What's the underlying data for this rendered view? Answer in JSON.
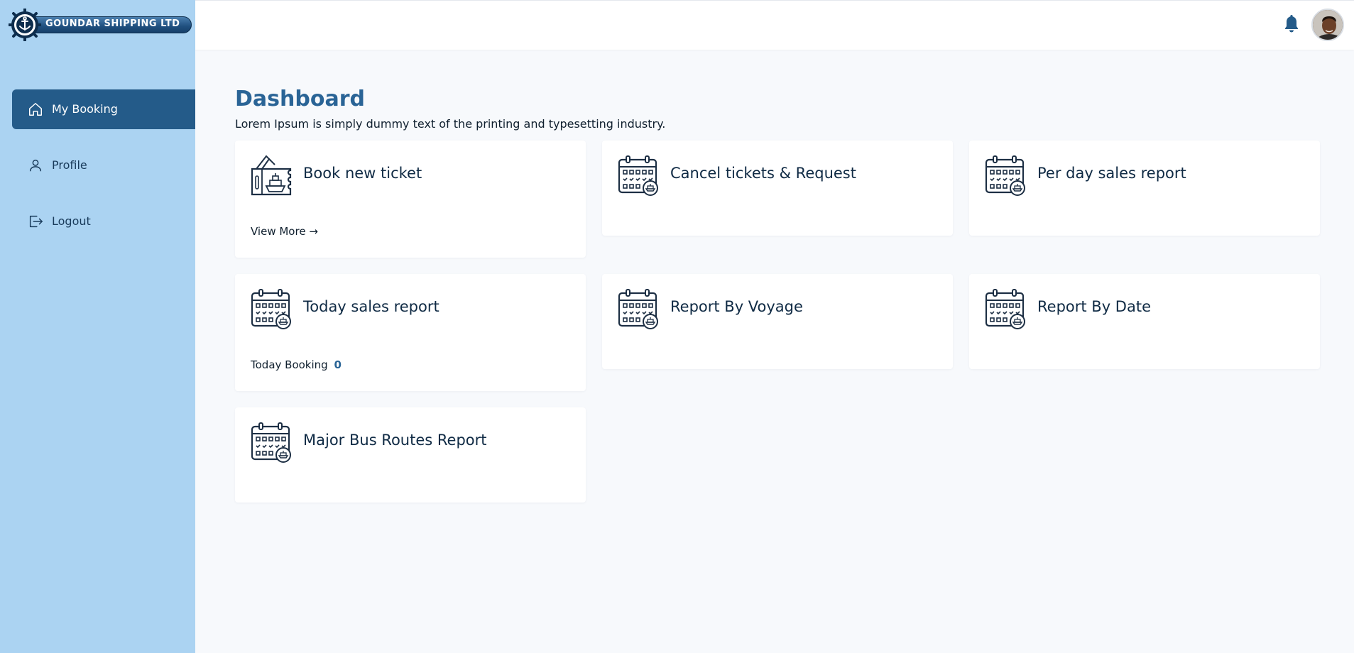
{
  "brand": {
    "name": "GOUNDAR SHIPPING LTD"
  },
  "sidebar": {
    "items": [
      {
        "label": "My Booking",
        "icon": "home-icon",
        "active": true
      },
      {
        "label": "Profile",
        "icon": "user-icon",
        "active": false
      },
      {
        "label": "Logout",
        "icon": "logout-icon",
        "active": false
      }
    ]
  },
  "header": {
    "notification_icon": "bell-icon",
    "avatar": "user-avatar"
  },
  "page": {
    "title": "Dashboard",
    "subtitle": "Lorem Ipsum is simply dummy text of the printing and typesetting industry."
  },
  "cards": [
    {
      "title": "Book new ticket",
      "icon": "ticket-ship-icon",
      "footer_label": "View More",
      "footer_arrow": "→"
    },
    {
      "title": "Cancel tickets & Request",
      "icon": "calendar-ship-icon"
    },
    {
      "title": "Per day sales report",
      "icon": "calendar-ship-icon"
    },
    {
      "title": "Today sales report",
      "icon": "calendar-ship-icon",
      "footer_label": "Today Booking",
      "footer_value": "0"
    },
    {
      "title": "Report By Voyage",
      "icon": "calendar-ship-icon"
    },
    {
      "title": "Report By Date",
      "icon": "calendar-ship-icon"
    },
    {
      "title": "Major Bus Routes Report",
      "icon": "calendar-ship-icon"
    }
  ],
  "colors": {
    "sidebar_bg": "#abd3f2",
    "active_nav": "#245b89",
    "accent": "#2a6496",
    "background": "#f7f9fc"
  }
}
